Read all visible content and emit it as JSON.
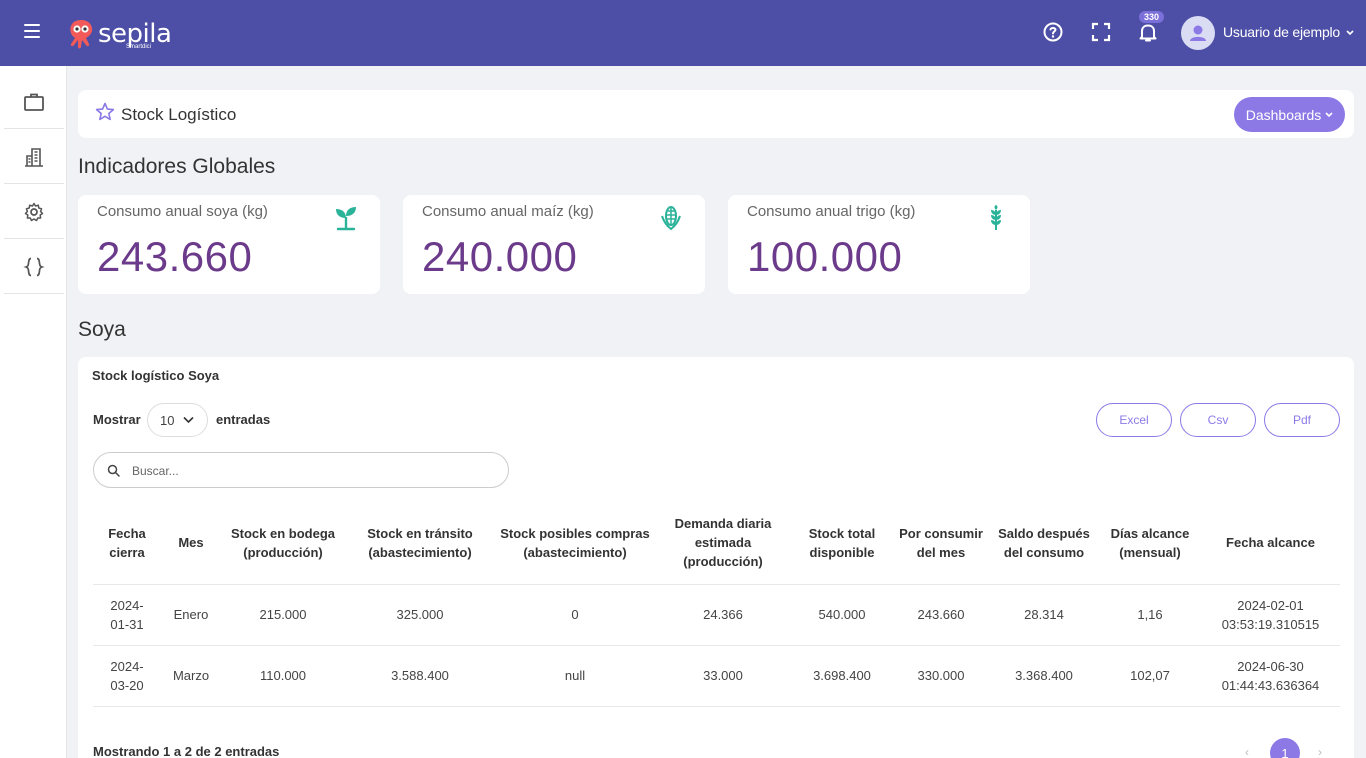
{
  "topbar": {
    "logo_text": "sepila",
    "logo_sub": "Smartdici",
    "notification_count": "330",
    "user_name": "Usuario de ejemplo"
  },
  "header": {
    "title": "Stock Logístico",
    "dashboards_label": "Dashboards"
  },
  "sections": {
    "global": "Indicadores Globales",
    "soya": "Soya"
  },
  "kpis": [
    {
      "label": "Consumo anual soya (kg)",
      "value": "243.660",
      "icon": "sprout-icon"
    },
    {
      "label": "Consumo anual maíz (kg)",
      "value": "240.000",
      "icon": "corn-icon"
    },
    {
      "label": "Consumo anual trigo (kg)",
      "value": "100.000",
      "icon": "wheat-icon"
    }
  ],
  "table_card": {
    "title": "Stock logístico Soya",
    "show_label": "Mostrar",
    "entries_value": "10",
    "entries_label": "entradas",
    "export": {
      "excel": "Excel",
      "csv": "Csv",
      "pdf": "Pdf"
    },
    "search_placeholder": "Buscar...",
    "columns": [
      "Fecha cierra",
      "Mes",
      "Stock en bodega (producción)",
      "Stock en tránsito (abastecimiento)",
      "Stock posibles compras (abastecimiento)",
      "Demanda diaria estimada (producción)",
      "Stock total disponible",
      "Por consumir del mes",
      "Saldo después del consumo",
      "Días alcance (mensual)",
      "Fecha alcance"
    ],
    "rows": [
      [
        "2024-01-31",
        "Enero",
        "215.000",
        "325.000",
        "0",
        "24.366",
        "540.000",
        "243.660",
        "28.314",
        "1,16",
        "2024-02-01 03:53:19.310515"
      ],
      [
        "2024-03-20",
        "Marzo",
        "110.000",
        "3.588.400",
        "null",
        "33.000",
        "3.698.400",
        "330.000",
        "3.368.400",
        "102,07",
        "2024-06-30 01:44:43.636364"
      ]
    ],
    "info_text": "Mostrando 1 a 2 de 2 entradas",
    "pager": {
      "prev": "‹",
      "current": "1",
      "next": "›"
    }
  },
  "colors": {
    "topbar": "#4d4fa6",
    "accent": "#8c79e6",
    "kpi_value": "#6b3a8a",
    "kpi_icon": "#2bb39a"
  }
}
